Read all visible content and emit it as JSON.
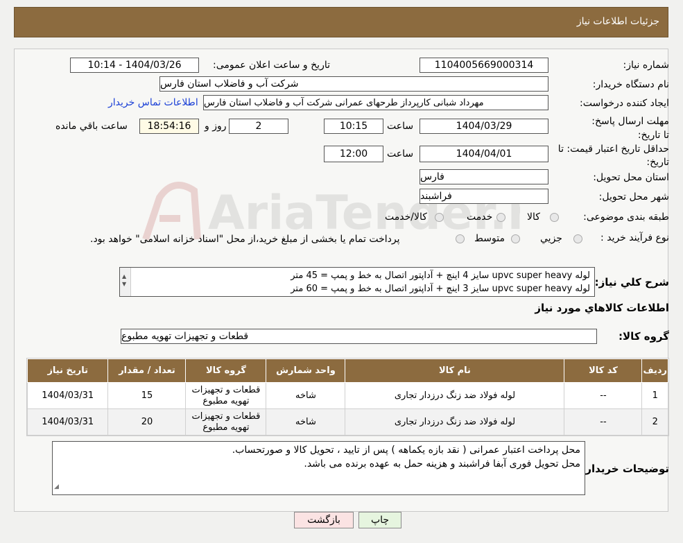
{
  "header": {
    "title": "جزئیات اطلاعات نیاز"
  },
  "fields": {
    "need_number_label": "شماره نیاز:",
    "need_number": "1104005669000314",
    "announce_label": "تاریخ و ساعت اعلان عمومی:",
    "announce_value": "1404/03/26 - 10:14",
    "buyer_org_label": "نام دستگاه خریدار:",
    "buyer_org": "شرکت آب و فاضلاب استان فارس",
    "creator_label": "ایجاد کننده درخواست:",
    "creator": "مهرداد شبانی کارپرداز طرحهای عمرانی  شرکت آب و فاضلاب استان فارس",
    "contact_link": "اطلاعات تماس خریدار",
    "deadline_label": "مهلت ارسال پاسخ: تا تاریخ:",
    "deadline_date": "1404/03/29",
    "time_label": "ساعت",
    "deadline_time": "10:15",
    "days_value": "2",
    "days_label": "روز و",
    "remaining_time": "18:54:16",
    "remaining_label": "ساعت باقي مانده",
    "validity_label": "حداقل تاریخ اعتبار قیمت: تا تاریخ:",
    "validity_date": "1404/04/01",
    "validity_time": "12:00",
    "province_label": "استان محل تحویل:",
    "province": "فارس",
    "city_label": "شهر محل تحویل:",
    "city": "فراشبند",
    "category_label": "طبقه بندی موضوعی:",
    "category_options": [
      "کالا",
      "خدمت",
      "کالا/خدمت"
    ],
    "process_label": "نوع فرآیند خرید :",
    "process_options": [
      "جزيي",
      "متوسط"
    ],
    "process_note": "پرداخت تمام یا بخشی از مبلغ خرید،از محل \"اسناد خزانه اسلامی\" خواهد بود."
  },
  "summary": {
    "label": "شرح کلي نياز:",
    "lines": [
      "لوله upvc super heavy سایز 4 اینچ + آداپتور اتصال به خط و پمپ = 45 متر",
      "لوله upvc super heavy سایز 3 اینچ + آداپتور اتصال به خط و  پمپ = 60 متر"
    ]
  },
  "goods_section": {
    "title": "اطلاعات کالاهاي مورد نياز",
    "group_label": "گروه کالا:",
    "group_value": "قطعات و تجهیزات تهویه مطبوع"
  },
  "table": {
    "columns": [
      "رديف",
      "کد کالا",
      "نام کالا",
      "واحد شمارش",
      "گروه کالا",
      "تعداد / مقدار",
      "تاریخ نیاز"
    ],
    "rows": [
      [
        "1",
        "--",
        "لوله فولاد ضد زنگ درزدار تجاری",
        "شاخه",
        "قطعات و تجهیزات تهویه مطبوع",
        "15",
        "1404/03/31"
      ],
      [
        "2",
        "--",
        "لوله فولاد ضد زنگ درزدار تجاری",
        "شاخه",
        "قطعات و تجهیزات تهویه مطبوع",
        "20",
        "1404/03/31"
      ]
    ]
  },
  "buyer_notes": {
    "label": "توضیحات خریدار:",
    "lines": [
      "محل پرداخت اعتبار عمرانی ( نقد بازه یکماهه ) پس از تایید ، تحویل  کالا و صورتحساب.",
      "محل تحویل فوری آبفا فراشبند و  هزینه حمل به عهده برنده می باشد."
    ]
  },
  "buttons": {
    "print": "چاپ",
    "back": "بازگشت"
  },
  "watermark": "AriaTender.neT",
  "colors": {
    "header_bg": "#8c6b3f",
    "link": "#1a3fd6"
  }
}
